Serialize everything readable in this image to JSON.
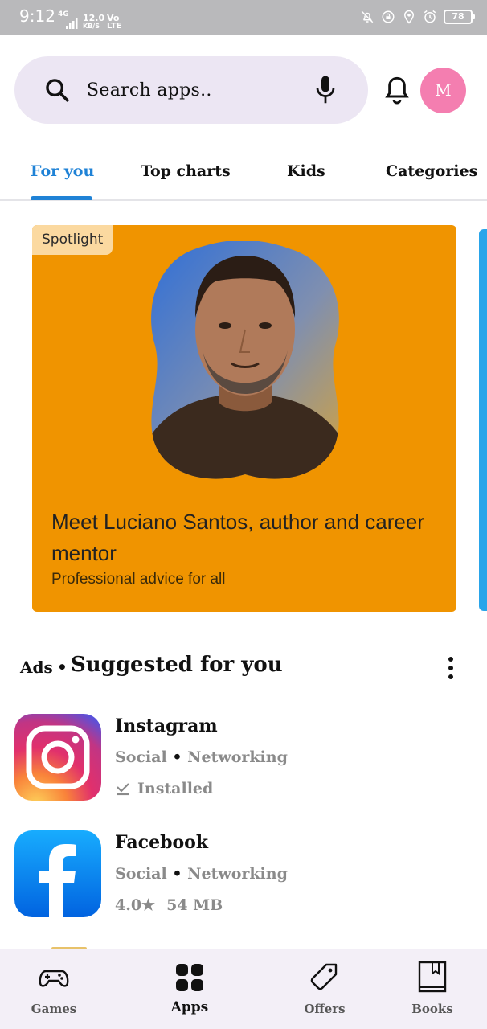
{
  "status_bar": {
    "time": "9:12",
    "network": "4G",
    "speed_value": "12.0",
    "speed_unit": "KB/S",
    "volte_top": "Vo",
    "volte_bottom": "LTE",
    "battery": "78"
  },
  "header": {
    "search_placeholder": "Search apps..",
    "avatar_initial": "M"
  },
  "tabs": [
    {
      "label": "For you",
      "active": true
    },
    {
      "label": "Top charts",
      "active": false
    },
    {
      "label": "Kids",
      "active": false
    },
    {
      "label": "Categories",
      "active": false
    }
  ],
  "spotlight": {
    "badge": "Spotlight",
    "title": "Meet Luciano Santos, author and career mentor",
    "subtitle": "Professional advice for all",
    "background_color": "#f09400"
  },
  "suggested": {
    "ads_label": "Ads",
    "separator": "•",
    "title": "Suggested for you",
    "apps": [
      {
        "name": "Instagram",
        "category": "Social",
        "subcategory": "Networking",
        "status": "Installed",
        "icon": "instagram-icon"
      },
      {
        "name": "Facebook",
        "category": "Social",
        "subcategory": "Networking",
        "rating": "4.0★",
        "size": "54 MB",
        "icon": "facebook-icon"
      }
    ]
  },
  "bottom_nav": [
    {
      "label": "Games",
      "icon": "gamepad-icon",
      "active": false
    },
    {
      "label": "Apps",
      "icon": "apps-grid-icon",
      "active": true
    },
    {
      "label": "Offers",
      "icon": "tag-icon",
      "active": false
    },
    {
      "label": "Books",
      "icon": "book-icon",
      "active": false
    }
  ],
  "colors": {
    "accent": "#1f82d6",
    "search_bg": "#ece6f3",
    "avatar_bg": "#f47eb0",
    "nav_bg": "#f3eff7"
  }
}
